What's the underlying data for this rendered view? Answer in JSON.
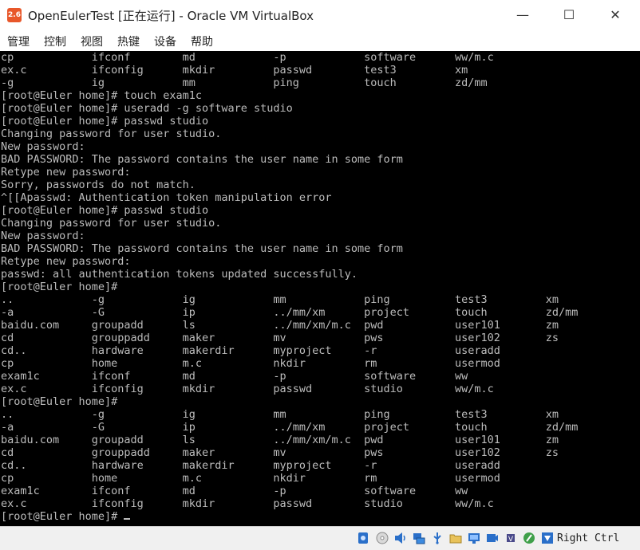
{
  "window": {
    "title": "OpenEulerTest [正在运行] - Oracle VM VirtualBox",
    "app_icon_text": "2.6",
    "minimize_glyph": "—",
    "maximize_glyph": "☐",
    "close_glyph": "✕"
  },
  "menu": {
    "items": [
      "管理",
      "控制",
      "视图",
      "热键",
      "设备",
      "帮助"
    ]
  },
  "terminal": {
    "text": "cp            ifconf        md            -p            software      ww/m.c\nex.c          ifconfig      mkdir         passwd        test3         xm\n-g            ig            mm            ping          touch         zd/mm\n[root@Euler home]# touch exam1c\n[root@Euler home]# useradd -g software studio\n[root@Euler home]# passwd studio\nChanging password for user studio.\nNew password:\nBAD PASSWORD: The password contains the user name in some form\nRetype new password:\nSorry, passwords do not match.\n^[[Apasswd: Authentication token manipulation error\n[root@Euler home]# passwd studio\nChanging password for user studio.\nNew password:\nBAD PASSWORD: The password contains the user name in some form\nRetype new password:\npasswd: all authentication tokens updated successfully.\n[root@Euler home]#\n..            -g            ig            mm            ping          test3         xm\n-a            -G            ip            ../mm/xm      project       touch         zd/mm\nbaidu.com     groupadd      ls            ../mm/xm/m.c  pwd           user101       zm\ncd            grouppadd     maker         mv            pws           user102       zs\ncd..          hardware      makerdir      myproject     -r            useradd\ncp            home          m.c           nkdir         rm            usermod\nexam1c        ifconf        md            -p            software      ww\nex.c          ifconfig      mkdir         passwd        studio        ww/m.c\n[root@Euler home]#\n..            -g            ig            mm            ping          test3         xm\n-a            -G            ip            ../mm/xm      project       touch         zd/mm\nbaidu.com     groupadd      ls            ../mm/xm/m.c  pwd           user101       zm\ncd            grouppadd     maker         mv            pws           user102       zs\ncd..          hardware      makerdir      myproject     -r            useradd\ncp            home          m.c           nkdir         rm            usermod\nexam1c        ifconf        md            -p            software      ww\nex.c          ifconfig      mkdir         passwd        studio        ww/m.c\n[root@Euler home]# "
  },
  "statusbar": {
    "host_key": "Right Ctrl"
  },
  "colors": {
    "console_bg": "#000000",
    "console_fg": "#bcbcbc",
    "app_icon": "#e8572a"
  }
}
